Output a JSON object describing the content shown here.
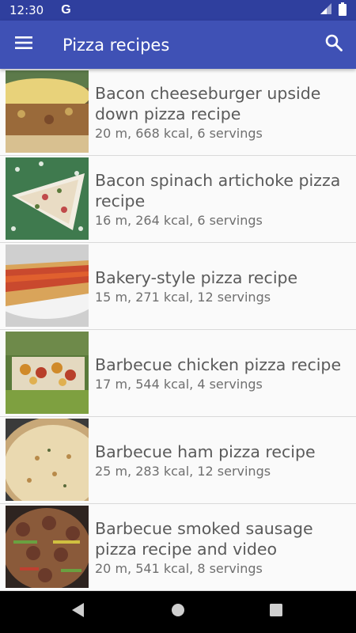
{
  "status_bar": {
    "time": "12:30",
    "g_icon": "G",
    "icons": [
      "signal-icon",
      "battery-icon"
    ]
  },
  "app_bar": {
    "title": "Pizza recipes",
    "menu_icon": "menu-icon",
    "search_icon": "search-icon"
  },
  "recipes": [
    {
      "title": "Bacon cheeseburger upside down pizza recipe",
      "meta": "20 m, 668 kcal, 6 servings"
    },
    {
      "title": "Bacon spinach artichoke pizza recipe",
      "meta": "16 m, 264 kcal, 6 servings"
    },
    {
      "title": "Bakery-style pizza recipe",
      "meta": "15 m, 271 kcal, 12 servings"
    },
    {
      "title": "Barbecue chicken pizza recipe",
      "meta": "17 m, 544 kcal, 4 servings"
    },
    {
      "title": "Barbecue ham pizza recipe",
      "meta": "25 m, 283 kcal, 12 servings"
    },
    {
      "title": "Barbecue smoked sausage pizza recipe and video",
      "meta": "20 m, 541 kcal, 8 servings"
    }
  ],
  "nav_bar": {
    "icons": [
      "back-icon",
      "home-icon",
      "recents-icon"
    ]
  },
  "colors": {
    "status_bar": "#2f3f9e",
    "app_bar": "#3f51b5",
    "title_text": "#5a5a5a",
    "meta_text": "#6f6f6f"
  }
}
